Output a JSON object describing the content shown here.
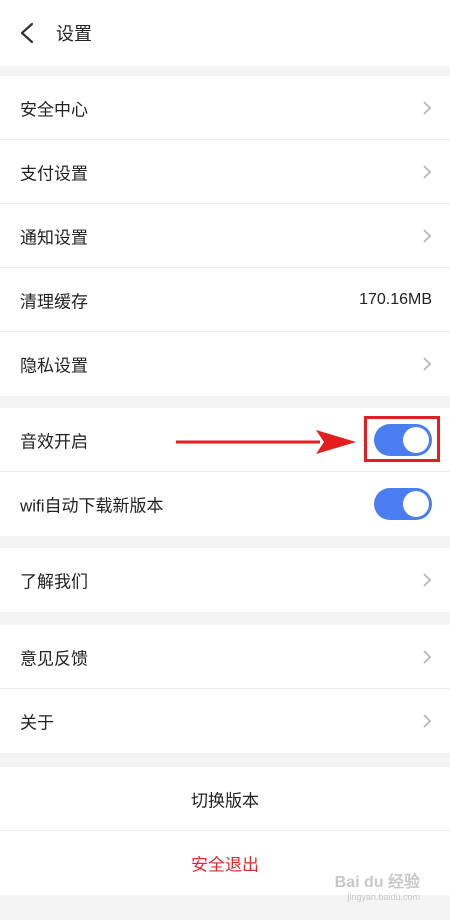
{
  "header": {
    "title": "设置",
    "back_icon": "chevron-left-icon"
  },
  "group1": {
    "items": [
      {
        "label": "安全中心"
      },
      {
        "label": "支付设置"
      },
      {
        "label": "通知设置"
      },
      {
        "label": "清理缓存",
        "value": "170.16MB"
      },
      {
        "label": "隐私设置"
      }
    ]
  },
  "group2": {
    "items": [
      {
        "label": "音效开启",
        "enabled": true
      },
      {
        "label": "wifi自动下载新版本",
        "enabled": true
      }
    ]
  },
  "group3": {
    "items": [
      {
        "label": "了解我们"
      }
    ]
  },
  "group4": {
    "items": [
      {
        "label": "意见反馈"
      },
      {
        "label": "关于"
      }
    ]
  },
  "group5": {
    "switch_version": "切换版本",
    "logout": "安全退出"
  },
  "colors": {
    "toggle_on": "#4a7ef0",
    "logout_red": "#e5282a",
    "annotation_red": "#e41e1e"
  },
  "watermark": {
    "text": "Bai du 经验",
    "sub": "jingyan.baidu.com"
  }
}
